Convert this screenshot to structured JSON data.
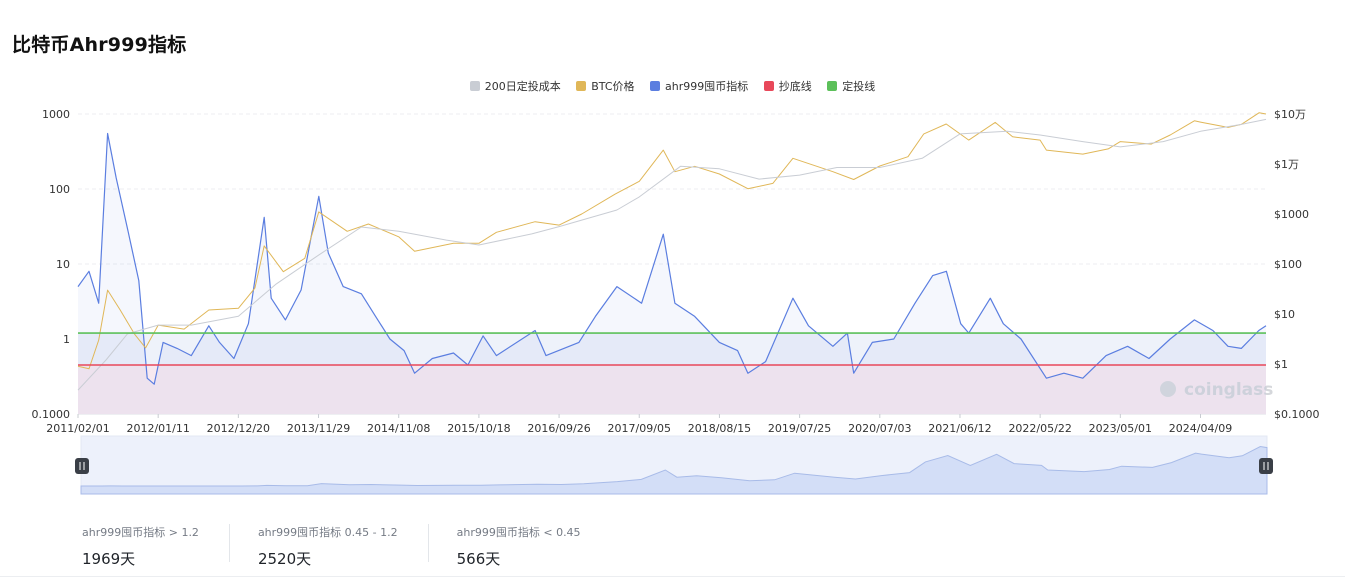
{
  "page": {
    "title": "比特币Ahr999指标"
  },
  "legend": [
    {
      "label": "200日定投成本",
      "color": "#c9cdd4"
    },
    {
      "label": "BTC价格",
      "color": "#e0b758"
    },
    {
      "label": "ahr999囤币指标",
      "color": "#5b7ee0"
    },
    {
      "label": "抄底线",
      "color": "#e8485a"
    },
    {
      "label": "定投线",
      "color": "#5cc05a"
    }
  ],
  "chart_data": {
    "type": "line",
    "x_scale": "time",
    "y_scale_left": "log",
    "y_scale_right": "log",
    "x_ticks": [
      "2011/02/01",
      "2012/01/11",
      "2012/12/20",
      "2013/11/29",
      "2014/11/08",
      "2015/10/18",
      "2016/09/26",
      "2017/09/05",
      "2018/08/15",
      "2019/07/25",
      "2020/07/03",
      "2021/06/12",
      "2022/05/22",
      "2023/05/01",
      "2024/04/09"
    ],
    "x_range": [
      "2011/02/01",
      "2025/01/15"
    ],
    "y_left_ticks": [
      "1000",
      "100",
      "10",
      "1",
      "0.1000"
    ],
    "y_left_range": [
      0.1,
      1000
    ],
    "y_right_ticks": [
      "$10万",
      "$1万",
      "$1000",
      "$100",
      "$10",
      "$1",
      "$0.1000"
    ],
    "y_right_range": [
      0.1,
      100000
    ],
    "reference_lines": [
      {
        "name": "抄底线",
        "value": 0.45,
        "color": "#e8485a"
      },
      {
        "name": "定投线",
        "value": 1.2,
        "color": "#5cc05a"
      }
    ],
    "grid": true,
    "legend_position": "top-center",
    "series": [
      {
        "name": "ahr999囤币指标",
        "axis": "left",
        "color": "#5b7ee0",
        "area": true,
        "points": [
          [
            "2011/02/01",
            5
          ],
          [
            "2011/03/20",
            8
          ],
          [
            "2011/05/01",
            3
          ],
          [
            "2011/06/08",
            550
          ],
          [
            "2011/07/15",
            140
          ],
          [
            "2011/09/01",
            30
          ],
          [
            "2011/10/20",
            6
          ],
          [
            "2011/11/25",
            0.3
          ],
          [
            "2011/12/25",
            0.25
          ],
          [
            "2012/02/01",
            0.9
          ],
          [
            "2012/04/01",
            0.75
          ],
          [
            "2012/06/01",
            0.6
          ],
          [
            "2012/08/15",
            1.5
          ],
          [
            "2012/09/30",
            0.9
          ],
          [
            "2012/12/01",
            0.55
          ],
          [
            "2013/02/01",
            1.6
          ],
          [
            "2013/04/10",
            42
          ],
          [
            "2013/05/10",
            3.5
          ],
          [
            "2013/07/10",
            1.8
          ],
          [
            "2013/09/15",
            4.5
          ],
          [
            "2013/11/30",
            80
          ],
          [
            "2014/01/10",
            14
          ],
          [
            "2014/03/15",
            5
          ],
          [
            "2014/06/01",
            4
          ],
          [
            "2014/08/01",
            2
          ],
          [
            "2014/10/01",
            1
          ],
          [
            "2014/12/01",
            0.7
          ],
          [
            "2015/01/15",
            0.35
          ],
          [
            "2015/04/01",
            0.55
          ],
          [
            "2015/07/01",
            0.65
          ],
          [
            "2015/09/01",
            0.45
          ],
          [
            "2015/11/05",
            1.1
          ],
          [
            "2016/01/01",
            0.6
          ],
          [
            "2016/06/15",
            1.3
          ],
          [
            "2016/08/01",
            0.6
          ],
          [
            "2016/12/20",
            0.9
          ],
          [
            "2017/03/01",
            2
          ],
          [
            "2017/06/01",
            5
          ],
          [
            "2017/09/15",
            3
          ],
          [
            "2017/12/17",
            25
          ],
          [
            "2018/02/05",
            3
          ],
          [
            "2018/05/01",
            2
          ],
          [
            "2018/08/15",
            0.9
          ],
          [
            "2018/11/01",
            0.7
          ],
          [
            "2018/12/15",
            0.35
          ],
          [
            "2019/03/01",
            0.5
          ],
          [
            "2019/06/26",
            3.5
          ],
          [
            "2019/09/01",
            1.5
          ],
          [
            "2019/12/15",
            0.8
          ],
          [
            "2020/02/15",
            1.2
          ],
          [
            "2020/03/13",
            0.35
          ],
          [
            "2020/06/01",
            0.9
          ],
          [
            "2020/09/01",
            1
          ],
          [
            "2020/12/01",
            3
          ],
          [
            "2021/02/15",
            7
          ],
          [
            "2021/04/15",
            8
          ],
          [
            "2021/06/15",
            1.6
          ],
          [
            "2021/07/20",
            1.2
          ],
          [
            "2021/10/20",
            3.5
          ],
          [
            "2021/12/15",
            1.6
          ],
          [
            "2022/03/01",
            1
          ],
          [
            "2022/06/18",
            0.3
          ],
          [
            "2022/09/01",
            0.35
          ],
          [
            "2022/11/21",
            0.3
          ],
          [
            "2023/03/01",
            0.6
          ],
          [
            "2023/06/01",
            0.8
          ],
          [
            "2023/09/01",
            0.55
          ],
          [
            "2023/12/01",
            1
          ],
          [
            "2024/03/14",
            1.8
          ],
          [
            "2024/06/01",
            1.3
          ],
          [
            "2024/08/05",
            0.8
          ],
          [
            "2024/10/01",
            0.75
          ],
          [
            "2024/12/15",
            1.3
          ],
          [
            "2025/01/15",
            1.5
          ]
        ]
      },
      {
        "name": "BTC价格",
        "axis": "right",
        "color": "#e0b758",
        "points": [
          [
            "2011/02/01",
            0.9
          ],
          [
            "2011/03/20",
            0.8
          ],
          [
            "2011/05/01",
            3
          ],
          [
            "2011/06/08",
            30
          ],
          [
            "2011/08/01",
            12
          ],
          [
            "2011/10/01",
            4
          ],
          [
            "2011/11/18",
            2.1
          ],
          [
            "2012/01/11",
            6
          ],
          [
            "2012/05/01",
            5
          ],
          [
            "2012/08/15",
            12
          ],
          [
            "2012/12/20",
            13
          ],
          [
            "2013/03/01",
            33
          ],
          [
            "2013/04/10",
            230
          ],
          [
            "2013/07/01",
            70
          ],
          [
            "2013/10/01",
            130
          ],
          [
            "2013/11/30",
            1100
          ],
          [
            "2014/04/01",
            450
          ],
          [
            "2014/07/01",
            630
          ],
          [
            "2014/11/08",
            350
          ],
          [
            "2015/01/15",
            180
          ],
          [
            "2015/07/01",
            260
          ],
          [
            "2015/10/18",
            260
          ],
          [
            "2016/01/01",
            430
          ],
          [
            "2016/06/15",
            700
          ],
          [
            "2016/09/26",
            600
          ],
          [
            "2017/01/01",
            1000
          ],
          [
            "2017/05/25",
            2500
          ],
          [
            "2017/09/05",
            4500
          ],
          [
            "2017/12/17",
            19000
          ],
          [
            "2018/02/05",
            7000
          ],
          [
            "2018/05/01",
            9000
          ],
          [
            "2018/08/15",
            6300
          ],
          [
            "2018/12/15",
            3200
          ],
          [
            "2019/04/01",
            4100
          ],
          [
            "2019/06/26",
            13000
          ],
          [
            "2019/12/15",
            7000
          ],
          [
            "2020/03/13",
            4900
          ],
          [
            "2020/07/03",
            9100
          ],
          [
            "2020/11/01",
            14000
          ],
          [
            "2021/01/08",
            40000
          ],
          [
            "2021/04/14",
            63000
          ],
          [
            "2021/07/20",
            30000
          ],
          [
            "2021/11/10",
            68000
          ],
          [
            "2022/01/24",
            35000
          ],
          [
            "2022/05/22",
            30000
          ],
          [
            "2022/06/18",
            19000
          ],
          [
            "2022/11/21",
            15800
          ],
          [
            "2023/03/10",
            20000
          ],
          [
            "2023/05/01",
            28000
          ],
          [
            "2023/09/11",
            25000
          ],
          [
            "2023/12/01",
            38000
          ],
          [
            "2024/03/14",
            73000
          ],
          [
            "2024/04/09",
            69000
          ],
          [
            "2024/08/05",
            54000
          ],
          [
            "2024/10/01",
            62000
          ],
          [
            "2024/12/17",
            106000
          ],
          [
            "2025/01/15",
            100000
          ]
        ]
      },
      {
        "name": "200日定投成本",
        "axis": "right",
        "color": "#c9cdd4",
        "points": [
          [
            "2011/02/01",
            0.3
          ],
          [
            "2011/06/01",
            1.2
          ],
          [
            "2011/09/01",
            4
          ],
          [
            "2012/01/11",
            6
          ],
          [
            "2012/06/01",
            6
          ],
          [
            "2012/12/20",
            9
          ],
          [
            "2013/06/01",
            40
          ],
          [
            "2013/11/29",
            150
          ],
          [
            "2014/06/01",
            550
          ],
          [
            "2014/11/08",
            450
          ],
          [
            "2015/06/01",
            300
          ],
          [
            "2015/10/18",
            240
          ],
          [
            "2016/06/01",
            400
          ],
          [
            "2016/09/26",
            560
          ],
          [
            "2017/06/01",
            1200
          ],
          [
            "2017/09/05",
            2200
          ],
          [
            "2018/03/01",
            9000
          ],
          [
            "2018/08/15",
            8000
          ],
          [
            "2019/02/01",
            5000
          ],
          [
            "2019/07/25",
            6000
          ],
          [
            "2020/01/01",
            8500
          ],
          [
            "2020/07/03",
            8500
          ],
          [
            "2021/01/01",
            13000
          ],
          [
            "2021/06/12",
            40000
          ],
          [
            "2022/01/01",
            45000
          ],
          [
            "2022/05/22",
            38000
          ],
          [
            "2022/11/21",
            28000
          ],
          [
            "2023/05/01",
            22000
          ],
          [
            "2023/11/01",
            28000
          ],
          [
            "2024/04/09",
            45000
          ],
          [
            "2024/10/01",
            62000
          ],
          [
            "2025/01/15",
            78000
          ]
        ]
      }
    ],
    "navigator": {
      "left_handle_icon": "pause-icon",
      "right_handle_icon": "pause-icon"
    },
    "watermark": "coinglass"
  },
  "stats": [
    {
      "label": "ahr999囤币指标 > 1.2",
      "value": "1969天"
    },
    {
      "label": "ahr999囤币指标 0.45 - 1.2",
      "value": "2520天"
    },
    {
      "label": "ahr999囤币指标 < 0.45",
      "value": "566天"
    }
  ]
}
